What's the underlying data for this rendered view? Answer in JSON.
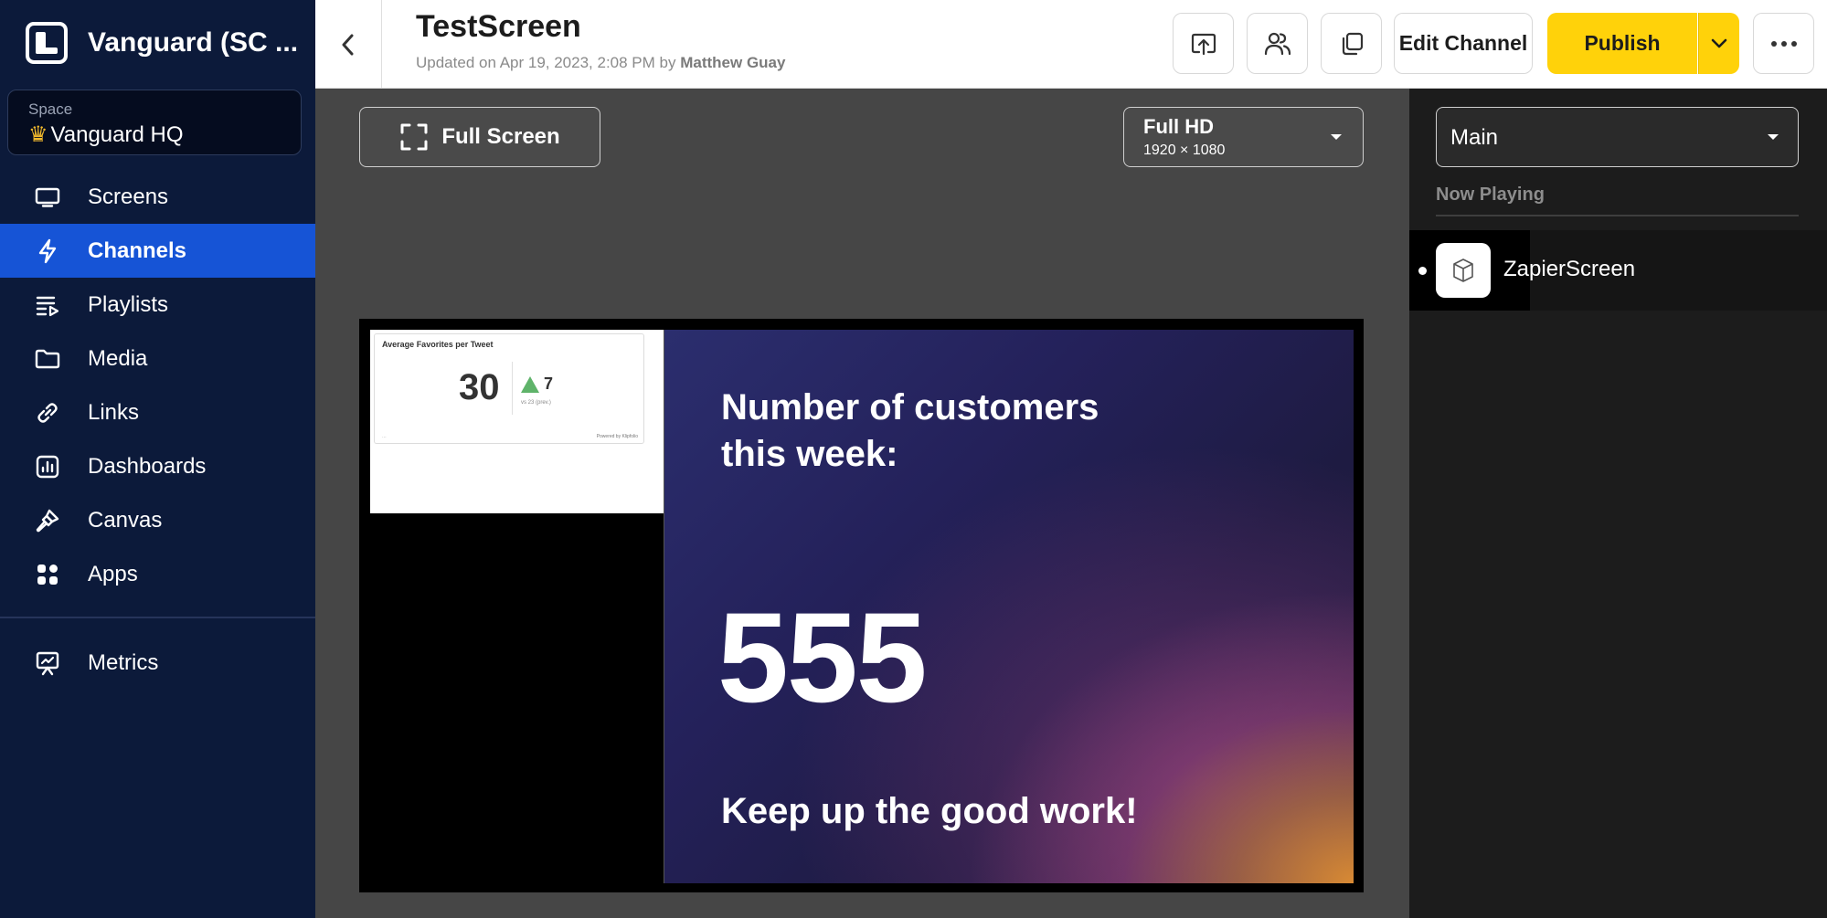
{
  "sidebar": {
    "brand_name": "Vanguard (SC ...",
    "space_label": "Space",
    "space_value": "Vanguard HQ",
    "items": [
      {
        "label": "Screens",
        "icon": "monitor-icon"
      },
      {
        "label": "Channels",
        "icon": "lightning-icon",
        "active": true
      },
      {
        "label": "Playlists",
        "icon": "playlist-icon"
      },
      {
        "label": "Media",
        "icon": "folder-icon"
      },
      {
        "label": "Links",
        "icon": "link-icon"
      },
      {
        "label": "Dashboards",
        "icon": "dashboard-icon"
      },
      {
        "label": "Canvas",
        "icon": "paintbrush-icon"
      },
      {
        "label": "Apps",
        "icon": "apps-icon"
      }
    ],
    "bottom_items": [
      {
        "label": "Metrics",
        "icon": "presentation-chart-icon"
      }
    ]
  },
  "header": {
    "title": "TestScreen",
    "updated_prefix": "Updated on Apr 19, 2023, 2:08 PM by",
    "updated_author": "Matthew Guay",
    "edit_label": "Edit Channel",
    "publish_label": "Publish"
  },
  "preview": {
    "fullscreen_label": "Full Screen",
    "resolution_title": "Full HD",
    "resolution_sub": "1920 × 1080",
    "widget": {
      "title": "Average Favorites per Tweet",
      "value": "30",
      "delta": "7",
      "comparison": "vs 23 (prev.)",
      "powered": "Powered by Klipfolio"
    },
    "slide": {
      "heading": "Number of customers this week:",
      "number": "555",
      "footer": "Keep up the good work!"
    }
  },
  "right_panel": {
    "zone": "Main",
    "now_playing_label": "Now Playing",
    "playing_item": "ZapierScreen"
  },
  "colors": {
    "sidebar_bg": "#0c1a3a",
    "active_nav": "#1654d6",
    "publish": "#ffd20a"
  }
}
